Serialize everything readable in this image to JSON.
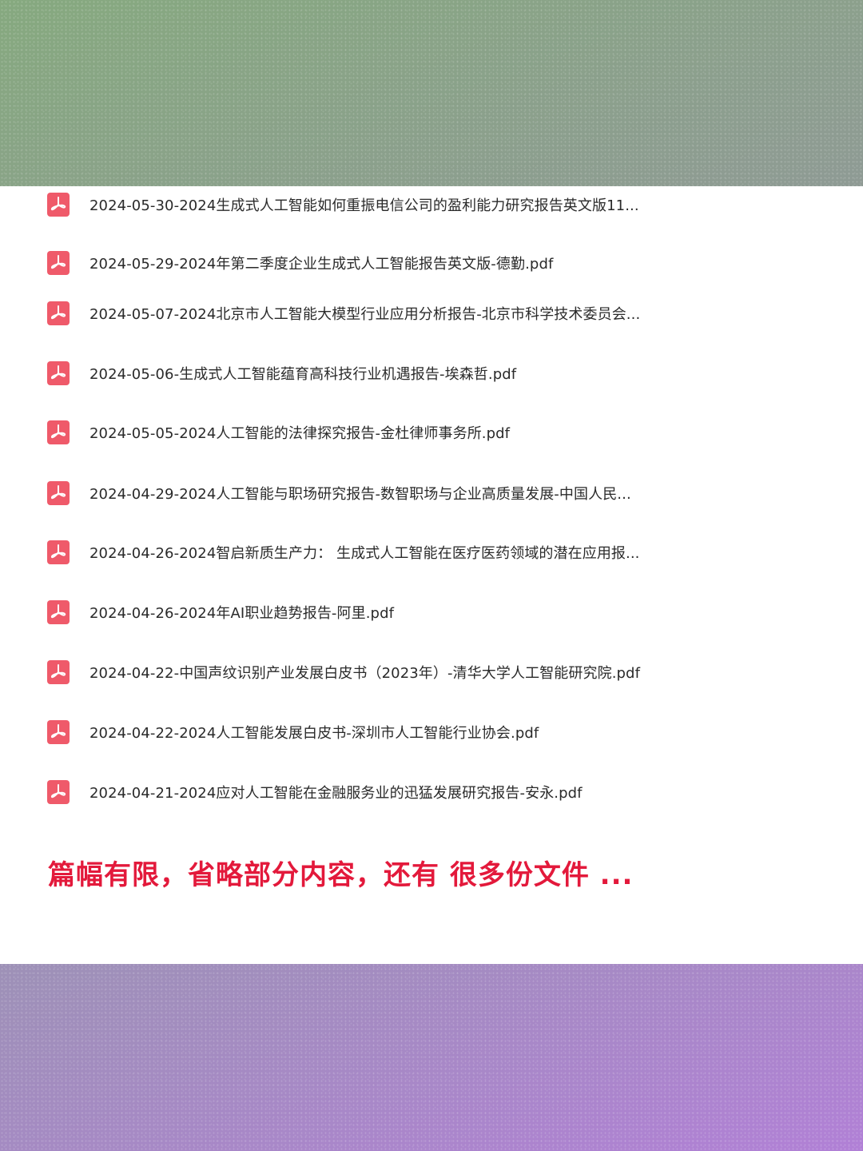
{
  "files": [
    {
      "name": "2024-05-30-2024生成式人工智能如何重振电信公司的盈利能力研究报告英文版11...",
      "icon": "pdf-icon"
    },
    {
      "name": "2024-05-29-2024年第二季度企业生成式人工智能报告英文版-德勤.pdf",
      "icon": "pdf-icon"
    },
    {
      "name": "2024-05-07-2024北京市人工智能大模型行业应用分析报告-北京市科学技术委员会...",
      "icon": "pdf-icon"
    },
    {
      "name": "2024-05-06-生成式人工智能蕴育高科技行业机遇报告-埃森哲.pdf",
      "icon": "pdf-icon"
    },
    {
      "name": "2024-05-05-2024人工智能的法律探究报告-金杜律师事务所.pdf",
      "icon": "pdf-icon"
    },
    {
      "name": "2024-04-29-2024人工智能与职场研究报告-数智职场与企业高质量发展-中国人民...",
      "icon": "pdf-icon"
    },
    {
      "name": "2024-04-26-2024智启新质生产力： 生成式人工智能在医疗医药领域的潜在应用报...",
      "icon": "pdf-icon"
    },
    {
      "name": "2024-04-26-2024年AI职业趋势报告-阿里.pdf",
      "icon": "pdf-icon"
    },
    {
      "name": "2024-04-22-中国声纹识别产业发展白皮书（2023年）-清华大学人工智能研究院.pdf",
      "icon": "pdf-icon"
    },
    {
      "name": "2024-04-22-2024人工智能发展白皮书-深圳市人工智能行业协会.pdf",
      "icon": "pdf-icon"
    },
    {
      "name": "2024-04-21-2024应对人工智能在金融服务业的迅猛发展研究报告-安永.pdf",
      "icon": "pdf-icon"
    }
  ],
  "notice": "篇幅有限，省略部分内容，还有 很多份文件 ...",
  "colors": {
    "notice": "#e3193b",
    "pdf_icon": "#ef5a6a"
  }
}
